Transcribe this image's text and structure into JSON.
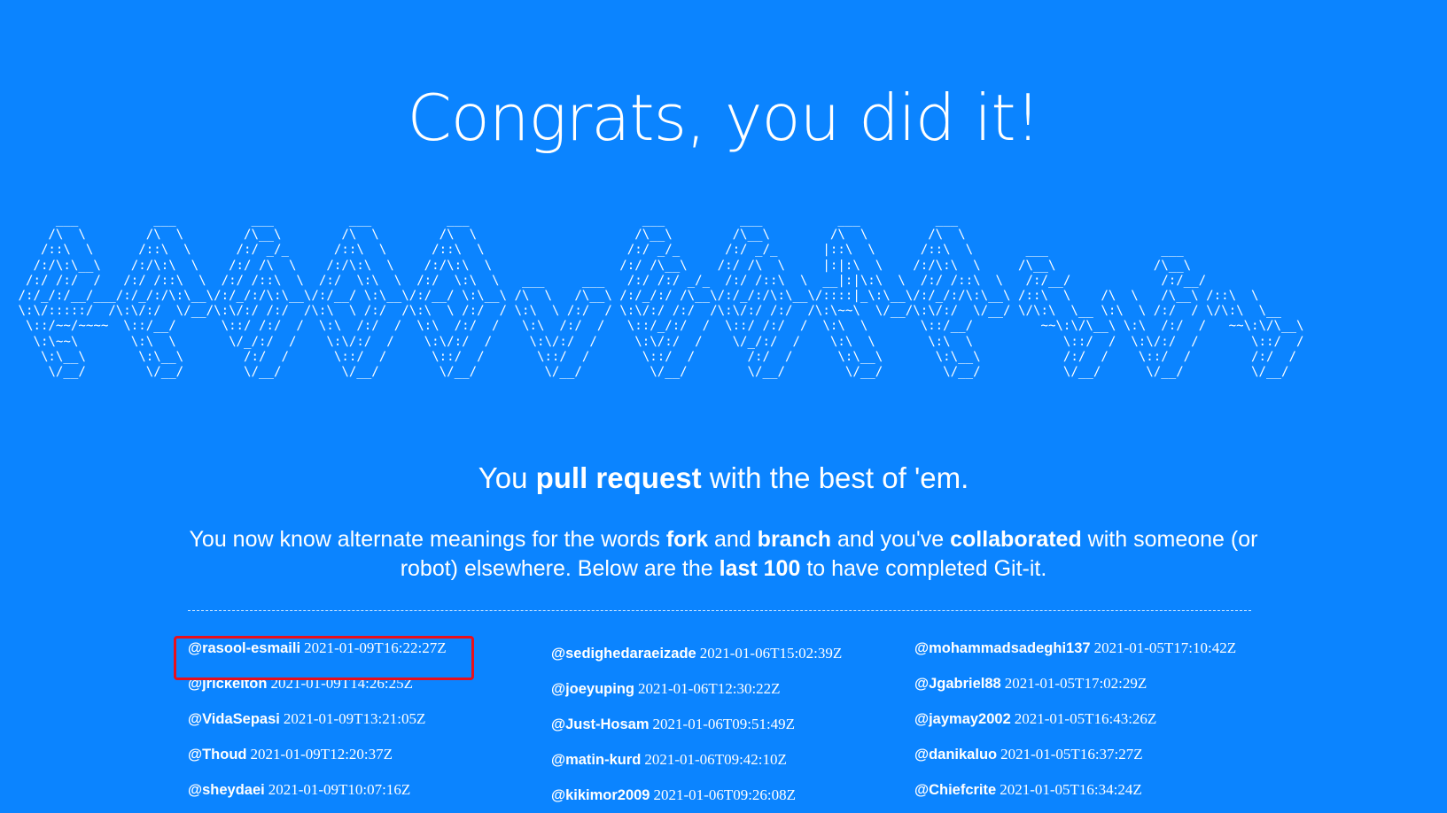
{
  "page": {
    "title": "Congrats, you did it!",
    "tagline": {
      "pre": "You ",
      "bold": "pull request",
      "post": " with the best of 'em."
    },
    "description": {
      "p1": "You now know alternate meanings for the words ",
      "b1": "fork",
      "p2": " and ",
      "b2": "branch",
      "p3": " and you've ",
      "b3": "collaborated",
      "p4": " with someone (or robot) elsewhere. Below are the ",
      "b4": "last 100",
      "p5": " to have completed Git-it."
    }
  },
  "ascii_art": "      ___          ___          ___          ___          ___                       ___          ___          ___          ___                                    \n     /\\  \\        /\\  \\        /\\__\\        /\\  \\        /\\  \\                     /\\__\\        /\\__\\        /\\  \\        /\\  \\                                   \n    /::\\  \\      /::\\  \\      /:/ _/_      /::\\  \\      /::\\  \\                   /:/ _/_      /:/ _/_      |::\\  \\      /::\\  \\       ___               ___     \n   /:/\\:\\__\\    /:/\\:\\  \\    /:/ /\\  \\    /:/\\:\\  \\    /:/\\:\\  \\                 /:/ /\\__\\    /:/ /\\  \\     |:|:\\  \\    /:/\\:\\  \\     /\\__\\             /\\__\\    \n  /:/ /:/  /   /:/ /::\\  \\  /:/ /::\\  \\  /:/  \\:\\  \\  /:/  \\:\\  \\   ___     ___   /:/ /:/ _/_  /:/ /::\\  \\  __|:|\\:\\  \\  /:/ /::\\  \\   /:/__/            /:/__/    \n /:/_/:/__/___/:/_/:/\\:\\__\\/:/_/:/\\:\\__\\/:/__/ \\:\\__\\/:/__/ \\:\\__\\ /\\  \\   /\\__\\ /:/_/:/ /\\__\\/:/_/:/\\:\\__\\/::::|_\\:\\__\\/:/_/:/\\:\\__\\ /::\\  \\    /\\  \\   /\\__\\ /::\\  \\    \n \\:\\/:::::/  /\\:\\/:/  \\/__/\\:\\/:/ /:/  /\\:\\  \\ /:/  /\\:\\  \\ /:/  / \\:\\  \\ /:/  / \\:\\/:/ /:/  /\\:\\/:/ /:/  /\\:\\~~\\  \\/__/\\:\\/:/  \\/__/ \\/\\:\\  \\__ \\:\\  \\ /:/  / \\/\\:\\  \\__ \n  \\::/~~/~~~~  \\::/__/      \\::/ /:/  /  \\:\\  /:/  /  \\:\\  /:/  /   \\:\\  /:/  /   \\::/_/:/  /  \\::/ /:/  /  \\:\\  \\       \\::/__/         ~~\\:\\/\\__\\ \\:\\  /:/  /   ~~\\:\\/\\__\\\n   \\:\\~~\\       \\:\\  \\       \\/_/:/  /    \\:\\/:/  /    \\:\\/:/  /     \\:\\/:/  /     \\:\\/:/  /    \\/_/:/  /    \\:\\  \\       \\:\\  \\            \\::/  /  \\:\\/:/  /       \\::/  / \n    \\:\\__\\       \\:\\__\\        /:/  /      \\::/  /      \\::/  /       \\::/  /       \\::/  /       /:/  /      \\:\\__\\       \\:\\__\\           /:/  /    \\::/  /        /:/  /  \n     \\/__/        \\/__/        \\/__/        \\/__/        \\/__/         \\/__/         \\/__/        \\/__/        \\/__/        \\/__/           \\/__/      \\/__/         \\/__/   ",
  "completions": {
    "column_1": [
      {
        "user": "@rasool-esmaili",
        "time": "2021-01-09T16:22:27Z"
      },
      {
        "user": "@jrickelton",
        "time": "2021-01-09T14:26:25Z"
      },
      {
        "user": "@VidaSepasi",
        "time": "2021-01-09T13:21:05Z"
      },
      {
        "user": "@Thoud",
        "time": "2021-01-09T12:20:37Z"
      },
      {
        "user": "@sheydaei",
        "time": "2021-01-09T10:07:16Z"
      }
    ],
    "column_2": [
      {
        "user": "@sedighedaraeizade",
        "time": "2021-01-06T15:02:39Z"
      },
      {
        "user": "@joeyuping",
        "time": "2021-01-06T12:30:22Z"
      },
      {
        "user": "@Just-Hosam",
        "time": "2021-01-06T09:51:49Z"
      },
      {
        "user": "@matin-kurd",
        "time": "2021-01-06T09:42:10Z"
      },
      {
        "user": "@kikimor2009",
        "time": "2021-01-06T09:26:08Z"
      }
    ],
    "column_3": [
      {
        "user": "@mohammadsadeghi137",
        "time": "2021-01-05T17:10:42Z"
      },
      {
        "user": "@Jgabriel88",
        "time": "2021-01-05T17:02:29Z"
      },
      {
        "user": "@jaymay2002",
        "time": "2021-01-05T16:43:26Z"
      },
      {
        "user": "@danikaluo",
        "time": "2021-01-05T16:37:27Z"
      },
      {
        "user": "@Chiefcrite",
        "time": "2021-01-05T16:34:24Z"
      }
    ]
  },
  "colors": {
    "background": "#0b84ff",
    "text": "#ffffff",
    "highlight_border": "#e8101d"
  }
}
